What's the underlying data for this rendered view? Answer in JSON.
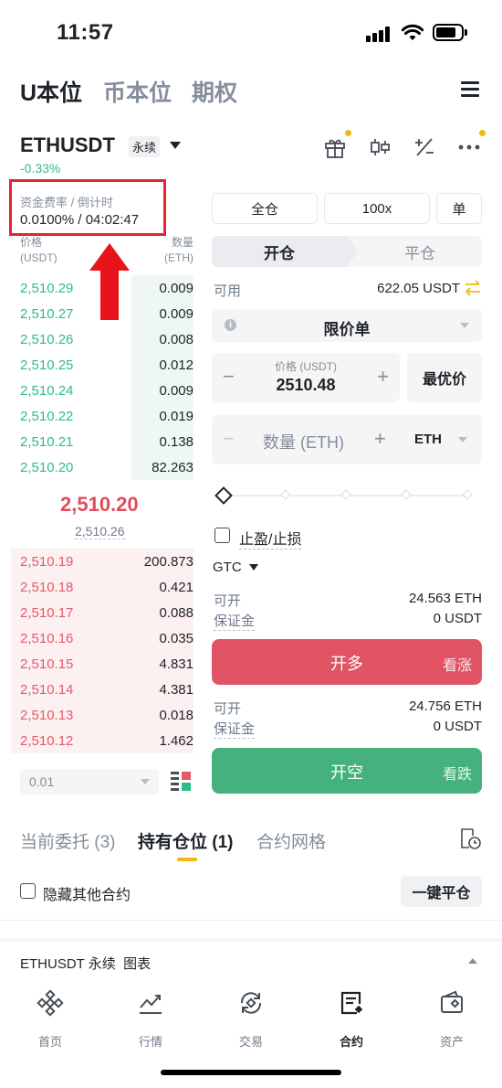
{
  "status_bar": {
    "time": "11:57"
  },
  "top_tabs": [
    {
      "label": "U本位",
      "active": true
    },
    {
      "label": "币本位",
      "active": false
    },
    {
      "label": "期权",
      "active": false
    }
  ],
  "symbol": {
    "name": "ETHUSDT",
    "type": "永续",
    "change": "-0.33%"
  },
  "funding": {
    "label": "资金费率 / 倒计时",
    "value": "0.0100% / 04:02:47"
  },
  "orderbook": {
    "price_header": [
      "价格",
      "(USDT)"
    ],
    "qty_header": [
      "数量",
      "(ETH)"
    ],
    "asks": [
      {
        "price": "2,510.29",
        "qty": "0.009"
      },
      {
        "price": "2,510.27",
        "qty": "0.009"
      },
      {
        "price": "2,510.26",
        "qty": "0.008"
      },
      {
        "price": "2,510.25",
        "qty": "0.012"
      },
      {
        "price": "2,510.24",
        "qty": "0.009"
      },
      {
        "price": "2,510.22",
        "qty": "0.019"
      },
      {
        "price": "2,510.21",
        "qty": "0.138"
      },
      {
        "price": "2,510.20",
        "qty": "82.263"
      }
    ],
    "last_price": "2,510.20",
    "mark_price": "2,510.26",
    "bids": [
      {
        "price": "2,510.19",
        "qty": "200.873"
      },
      {
        "price": "2,510.18",
        "qty": "0.421"
      },
      {
        "price": "2,510.17",
        "qty": "0.088"
      },
      {
        "price": "2,510.16",
        "qty": "0.035"
      },
      {
        "price": "2,510.15",
        "qty": "4.831"
      },
      {
        "price": "2,510.14",
        "qty": "4.381"
      },
      {
        "price": "2,510.13",
        "qty": "0.018"
      },
      {
        "price": "2,510.12",
        "qty": "1.462"
      }
    ],
    "depth": "0.01"
  },
  "order_form": {
    "margin_mode": "全仓",
    "leverage": "100x",
    "position_mode": "单",
    "open_tab": "开仓",
    "close_tab": "平仓",
    "available_label": "可用",
    "available_value": "622.05 USDT",
    "order_type": "限价单",
    "price_label": "价格 (USDT)",
    "price_value": "2510.48",
    "best_price": "最优价",
    "qty_placeholder": "数量 (ETH)",
    "qty_unit": "ETH",
    "tpsl_label": "止盈/止损",
    "tif": "GTC",
    "long": {
      "can_open_label": "可开",
      "can_open_value": "24.563 ETH",
      "margin_label": "保证金",
      "margin_value": "0 USDT",
      "button": "开多",
      "hint": "看涨"
    },
    "short": {
      "can_open_label": "可开",
      "can_open_value": "24.756 ETH",
      "margin_label": "保证金",
      "margin_value": "0 USDT",
      "button": "开空",
      "hint": "看跌"
    }
  },
  "positions": {
    "tabs": [
      {
        "label": "当前委托 (3)",
        "active": false
      },
      {
        "label": "持有仓位 (1)",
        "active": true
      },
      {
        "label": "合约网格",
        "active": false
      }
    ],
    "hide_other": "隐藏其他合约",
    "close_all": "一键平仓"
  },
  "chart_bar": {
    "label": "ETHUSDT 永续  图表"
  },
  "bottom_nav": [
    {
      "label": "首页",
      "icon": "home-icon",
      "active": false
    },
    {
      "label": "行情",
      "icon": "markets-icon",
      "active": false
    },
    {
      "label": "交易",
      "icon": "trade-icon",
      "active": false
    },
    {
      "label": "合约",
      "icon": "futures-icon",
      "active": true
    },
    {
      "label": "资产",
      "icon": "wallet-icon",
      "active": false
    }
  ],
  "colors": {
    "up": "#2ebd85",
    "down": "#e25b6a",
    "accent": "#f0b90b",
    "long_button": "#e05466",
    "short_button": "#45b17c"
  }
}
